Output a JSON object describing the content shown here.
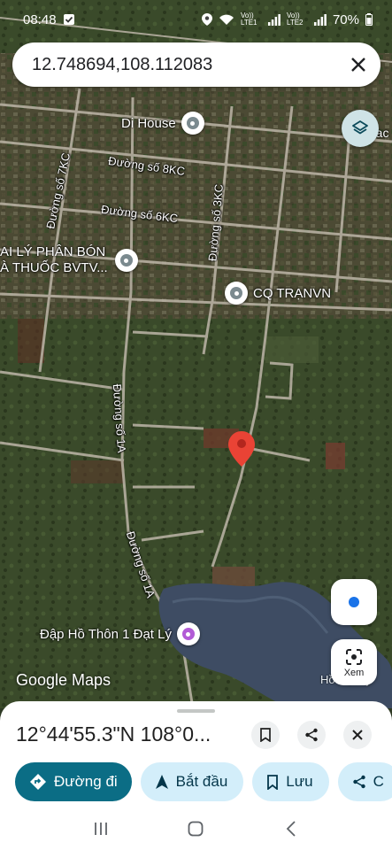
{
  "status_bar": {
    "time": "08:48",
    "volte1": "Vo)) LTE1",
    "volte2": "Vo)) LTE2",
    "battery": "70%"
  },
  "search": {
    "query": "12.748694,108.112083"
  },
  "map": {
    "road_labels": [
      "Đường số 8KC",
      "Đường số 6KC",
      "Đường số 7KC",
      "Đường số 3KC",
      "Đường số 1A",
      "Đường số 1A"
    ],
    "pois": {
      "di_house": "Di House",
      "dai_ly_line1": "AI LÝ PHÂN BÓN",
      "dai_ly_line2": "À THUỐC BVTV...",
      "cq_tranvn": "CQ TRẠNVN",
      "dap_ho": "Đập Hồ Thôn 1 Đạt Lý",
      "ho_dat_ly": "Hồ Đạt Lý",
      "trac": "rac"
    },
    "logo_text": "Google Maps",
    "lens_label": "Xem"
  },
  "sheet": {
    "title": "12°44'55.3\"N 108°0...",
    "chips": {
      "directions": "Đường đi",
      "start": "Bắt đầu",
      "save": "Lưu",
      "share": "C"
    }
  },
  "colors": {
    "primary_chip": "#0b6d85",
    "secondary_chip": "#d3eefa",
    "pin_red": "#ea4335",
    "location_blue": "#1a73e8"
  }
}
